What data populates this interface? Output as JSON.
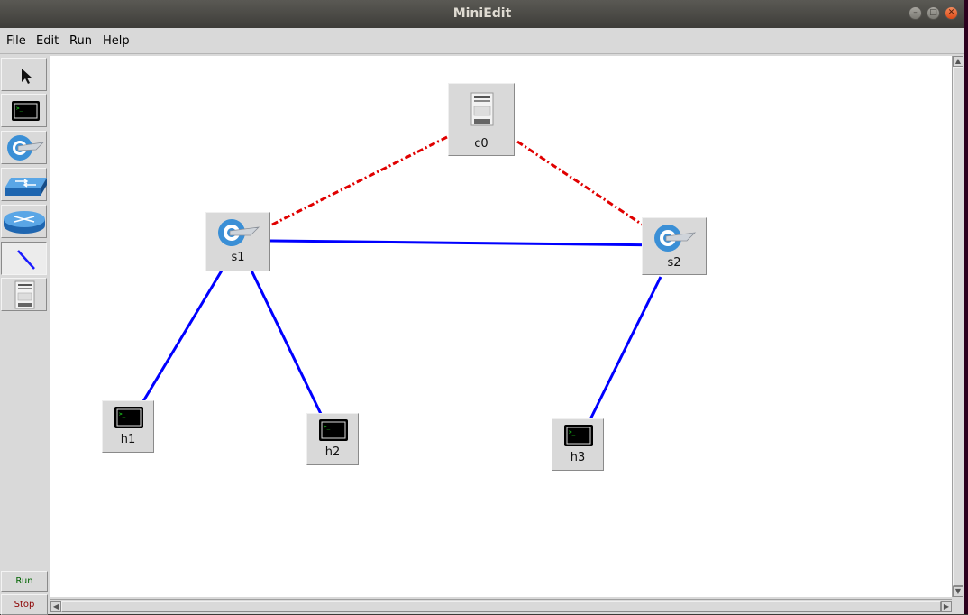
{
  "window": {
    "title": "MiniEdit",
    "controls": [
      "minimize-icon",
      "maximize-icon",
      "close-icon"
    ]
  },
  "menubar": {
    "items": [
      "File",
      "Edit",
      "Run",
      "Help"
    ]
  },
  "toolbar": {
    "tools": [
      {
        "name": "select-tool",
        "icon": "pointer-arrow-icon"
      },
      {
        "name": "host-tool",
        "icon": "terminal-host-icon"
      },
      {
        "name": "switch-tool",
        "icon": "openflow-switch-icon"
      },
      {
        "name": "legacy-switch-tool",
        "icon": "legacy-switch-icon"
      },
      {
        "name": "legacy-router-tool",
        "icon": "router-icon"
      },
      {
        "name": "link-tool",
        "icon": "link-line-icon",
        "active": true
      },
      {
        "name": "controller-tool",
        "icon": "controller-server-icon"
      }
    ],
    "run_label": "Run",
    "stop_label": "Stop"
  },
  "colors": {
    "link": "#0000ff",
    "controller_link": "#e00000",
    "run_text": "#006400",
    "stop_text": "#8b0000"
  },
  "topology": {
    "nodes": [
      {
        "id": "c0",
        "label": "c0",
        "type": "controller"
      },
      {
        "id": "s1",
        "label": "s1",
        "type": "switch"
      },
      {
        "id": "s2",
        "label": "s2",
        "type": "switch"
      },
      {
        "id": "h1",
        "label": "h1",
        "type": "host"
      },
      {
        "id": "h2",
        "label": "h2",
        "type": "host"
      },
      {
        "id": "h3",
        "label": "h3",
        "type": "host"
      }
    ],
    "links": [
      {
        "from": "s1",
        "to": "s2",
        "style": "solid"
      },
      {
        "from": "s1",
        "to": "h1",
        "style": "solid"
      },
      {
        "from": "s1",
        "to": "h2",
        "style": "solid"
      },
      {
        "from": "s2",
        "to": "h3",
        "style": "solid"
      },
      {
        "from": "c0",
        "to": "s1",
        "style": "dash-dot"
      },
      {
        "from": "c0",
        "to": "s2",
        "style": "dash-dot"
      }
    ]
  }
}
